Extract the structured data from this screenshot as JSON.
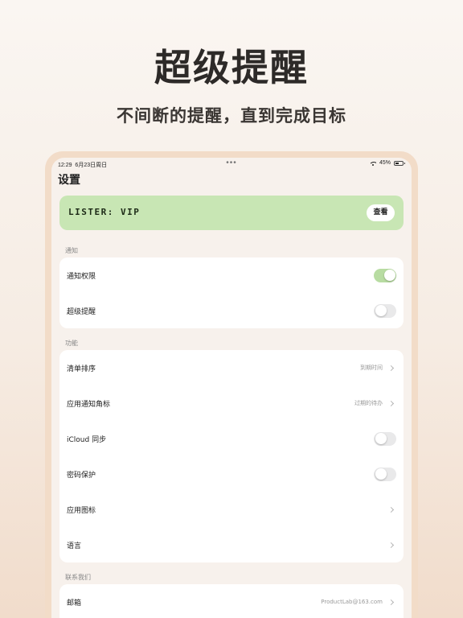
{
  "headline": "超级提醒",
  "subheadline": "不间断的提醒，直到完成目标",
  "statusbar": {
    "time": "12:29",
    "date": "6月23日周日",
    "dots": "•••",
    "battery": "45%",
    "battery_level": 0.45
  },
  "page_title": "设置",
  "vip": {
    "title": "LISTER: VIP",
    "button": "查看",
    "color": "#c8e6b4"
  },
  "sections": {
    "notify": {
      "header": "通知",
      "rows": [
        {
          "label": "通知权限",
          "toggle": true
        },
        {
          "label": "超级提醒",
          "toggle": false
        }
      ]
    },
    "features": {
      "header": "功能",
      "rows": [
        {
          "label": "清单排序",
          "value": "到期时间"
        },
        {
          "label": "应用通知角标",
          "value": "过期的待办"
        },
        {
          "label": "iCloud 同步",
          "toggle": false
        },
        {
          "label": "密码保护",
          "toggle": false
        },
        {
          "label": "应用图标",
          "value": ""
        },
        {
          "label": "语言",
          "value": ""
        }
      ]
    },
    "contact": {
      "header": "联系我们",
      "rows": [
        {
          "label": "邮箱",
          "value": "ProductLab@163.com"
        }
      ]
    }
  },
  "colors": {
    "toggle_on": "#b8dca2",
    "toggle_off": "#e9e9ea"
  }
}
